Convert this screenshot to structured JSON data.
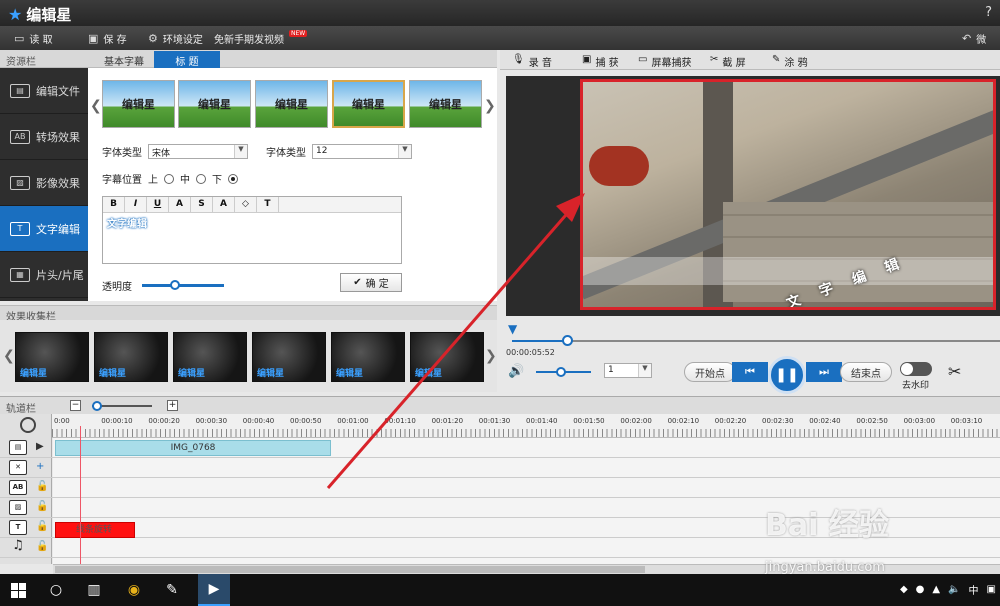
{
  "app": {
    "title": "编辑星",
    "help": "?"
  },
  "toolbar": {
    "read": "读  取",
    "save": "保  存",
    "env": "环境设定",
    "free": "免新手期发视频",
    "new_badge": "NEW",
    "right": "微"
  },
  "left": {
    "resource_label": "资源栏",
    "tab_basic": "基本字幕",
    "tab_title": "标  题",
    "sidebar": [
      {
        "label": "编辑文件",
        "icon": "film-icon"
      },
      {
        "label": "转场效果",
        "icon": "transition-ab-icon"
      },
      {
        "label": "影像效果",
        "icon": "image-effect-icon"
      },
      {
        "label": "文字编辑",
        "icon": "text-t-icon"
      },
      {
        "label": "片头/片尾",
        "icon": "intro-outro-icon"
      }
    ],
    "thumbs": [
      "编辑星",
      "编辑星",
      "编辑星",
      "编辑星",
      "编辑星"
    ],
    "font_label": "字体类型",
    "font_value": "宋体",
    "size_label": "字体类型",
    "size_value": "12",
    "pos_label": "字幕位置",
    "pos_top": "上",
    "pos_mid": "中",
    "pos_bottom": "下",
    "rte_buttons": [
      "B",
      "I",
      "U",
      "A",
      "S",
      "A",
      "◇",
      "T"
    ],
    "rte_text": "文字编辑",
    "opacity_label": "透明度",
    "opacity_value": 0.4,
    "confirm": "确  定"
  },
  "effects": {
    "label": "效果收集栏",
    "items": [
      "编辑星",
      "编辑星",
      "编辑星",
      "编辑星",
      "编辑星",
      "编辑星"
    ]
  },
  "right": {
    "tools": [
      "录  音",
      "捕  获",
      "屏幕捕获",
      "截  屏",
      "涂  鸦"
    ],
    "subtitle_overlay": "文 字 编 辑",
    "timecode": "00:00:05:52",
    "volume_select": "1",
    "start": "开始点",
    "end": "结束点",
    "watermark_toggle": "去水印"
  },
  "tracks": {
    "label": "轨道栏",
    "ruler": [
      "0:00",
      "00:00:10",
      "00:00:20",
      "00:00:30",
      "00:00:40",
      "00:00:50",
      "00:01:00",
      "00:01:10",
      "00:01:20",
      "00:01:30",
      "00:01:40",
      "00:01:50",
      "00:02:00",
      "00:02:10",
      "00:02:20",
      "00:02:30",
      "00:02:40",
      "00:02:50",
      "00:03:00",
      "00:03:10"
    ],
    "video_clip": "IMG_0768",
    "text_clip": "线条旋转"
  },
  "taskbar": {
    "lang": "中"
  },
  "watermark": {
    "big": "Bai 经验",
    "small": "jingyan.baidu.com"
  },
  "colors": {
    "accent": "#1a6fc0",
    "highlight": "#d8232a"
  }
}
